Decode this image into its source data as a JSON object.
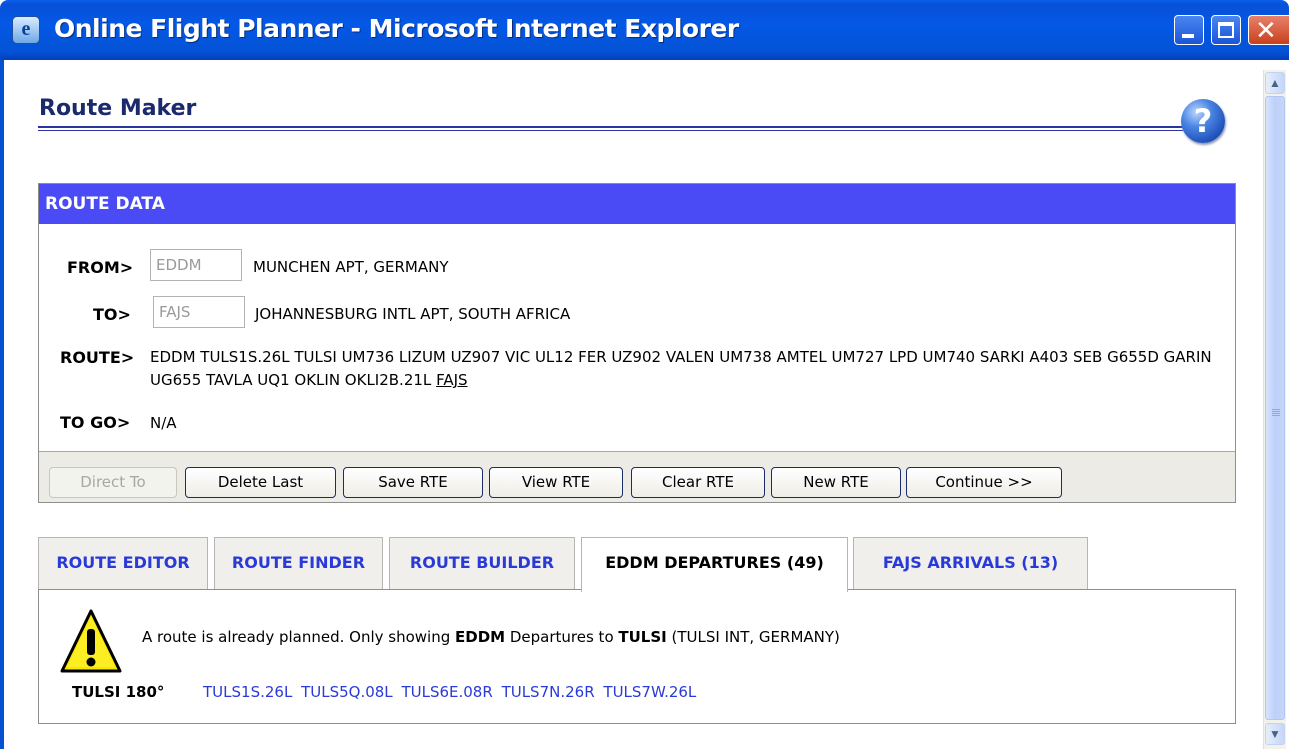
{
  "window": {
    "title": "Online Flight Planner - Microsoft Internet Explorer",
    "icon": "ie-page-icon",
    "controls": [
      "minimize-icon",
      "maximize-icon",
      "close-icon"
    ]
  },
  "page": {
    "title": "Route Maker",
    "help_label": "?"
  },
  "route_data": {
    "header": "ROUTE DATA",
    "from_label": "FROM>",
    "from_value": "EDDM",
    "from_name": "MUNCHEN APT, GERMANY",
    "to_label": "TO>",
    "to_value": "FAJS",
    "to_name": "JOHANNESBURG INTL APT, SOUTH AFRICA",
    "route_label": "ROUTE>",
    "route_text": "EDDM TULS1S.26L TULSI UM736 LIZUM UZ907 VIC UL12 FER UZ902 VALEN UM738 AMTEL UM727 LPD UM740 SARKI A403 SEB G655D GARIN UG655 TAVLA UQ1 OKLIN OKLI2B.21L",
    "route_dest": "FAJS",
    "togo_label": "TO GO>",
    "togo_value": "N/A"
  },
  "buttons": {
    "direct_to": "Direct To",
    "delete_last": "Delete Last",
    "save_rte": "Save RTE",
    "view_rte": "View RTE",
    "clear_rte": "Clear RTE",
    "new_rte": "New RTE",
    "continue": "Continue >>"
  },
  "tabs": [
    {
      "label": "ROUTE EDITOR",
      "active": false
    },
    {
      "label": "ROUTE FINDER",
      "active": false
    },
    {
      "label": "ROUTE BUILDER",
      "active": false
    },
    {
      "label": "EDDM DEPARTURES (49)",
      "active": true
    },
    {
      "label": "FAJS ARRIVALS (13)",
      "active": false
    }
  ],
  "departures": {
    "warning_icon": "warning-icon",
    "msg_prefix": "A route is already planned. Only showing ",
    "msg_airport": "EDDM",
    "msg_mid": " Departures to ",
    "msg_waypoint": "TULSI",
    "msg_suffix": " (TULSI INT, GERMANY)",
    "waypoint_label": "TULSI 180°",
    "procedures": [
      "TULS1S.26L",
      "TULS5Q.08L",
      "TULS6E.08R",
      "TULS7N.26R",
      "TULS7W.26L"
    ]
  },
  "colors": {
    "titlebar": "#0453d6",
    "panel_header": "#4a4bf5",
    "link": "#2a3ad8",
    "heading": "#1a2a6c"
  }
}
